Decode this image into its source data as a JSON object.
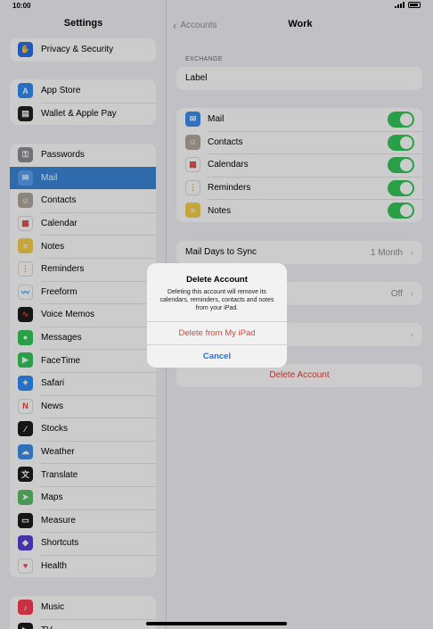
{
  "status": {
    "time": "10:00"
  },
  "sidebar": {
    "title": "Settings",
    "groups": [
      {
        "items": [
          {
            "label": "Privacy & Security",
            "icon": "hand-icon",
            "color": "#2c6de6"
          }
        ]
      },
      {
        "items": [
          {
            "label": "App Store",
            "icon": "app-store-icon",
            "color": "#2f8cf6"
          },
          {
            "label": "Wallet & Apple Pay",
            "icon": "wallet-icon",
            "color": "#222222"
          }
        ]
      },
      {
        "items": [
          {
            "label": "Passwords",
            "icon": "key-icon",
            "color": "#8e8e93"
          },
          {
            "label": "Mail",
            "icon": "mail-icon",
            "color": "#3d8ef0",
            "selected": true
          },
          {
            "label": "Contacts",
            "icon": "contacts-icon",
            "color": "#b0a89c"
          },
          {
            "label": "Calendar",
            "icon": "calendar-icon",
            "color": "#ffffff"
          },
          {
            "label": "Notes",
            "icon": "notes-icon",
            "color": "#f7d04a"
          },
          {
            "label": "Reminders",
            "icon": "reminders-icon",
            "color": "#ffffff"
          },
          {
            "label": "Freeform",
            "icon": "freeform-icon",
            "color": "#ffffff"
          },
          {
            "label": "Voice Memos",
            "icon": "voice-memos-icon",
            "color": "#1c1c1e"
          },
          {
            "label": "Messages",
            "icon": "messages-icon",
            "color": "#34c759"
          },
          {
            "label": "FaceTime",
            "icon": "facetime-icon",
            "color": "#34c759"
          },
          {
            "label": "Safari",
            "icon": "safari-icon",
            "color": "#2f8cf6"
          },
          {
            "label": "News",
            "icon": "news-icon",
            "color": "#ffffff"
          },
          {
            "label": "Stocks",
            "icon": "stocks-icon",
            "color": "#1c1c1e"
          },
          {
            "label": "Weather",
            "icon": "weather-icon",
            "color": "#3c8ee6"
          },
          {
            "label": "Translate",
            "icon": "translate-icon",
            "color": "#1c1c1e"
          },
          {
            "label": "Maps",
            "icon": "maps-icon",
            "color": "#5cbf6a"
          },
          {
            "label": "Measure",
            "icon": "measure-icon",
            "color": "#1c1c1e"
          },
          {
            "label": "Shortcuts",
            "icon": "shortcuts-icon",
            "color": "#5a3fd1"
          },
          {
            "label": "Health",
            "icon": "health-icon",
            "color": "#ffffff"
          }
        ]
      },
      {
        "items": [
          {
            "label": "Music",
            "icon": "music-icon",
            "color": "#fa3e55"
          },
          {
            "label": "TV",
            "icon": "tv-icon",
            "color": "#1c1c1e"
          }
        ]
      }
    ]
  },
  "detail": {
    "back_label": "Accounts",
    "title": "Work",
    "exchange_header": "EXCHANGE",
    "label_row": "Label",
    "services": [
      {
        "label": "Mail",
        "icon": "mail-icon",
        "color": "#3d8ef0"
      },
      {
        "label": "Contacts",
        "icon": "contacts-icon",
        "color": "#b0a89c"
      },
      {
        "label": "Calendars",
        "icon": "calendar-icon",
        "color": "#ffffff"
      },
      {
        "label": "Reminders",
        "icon": "reminders-icon",
        "color": "#ffffff"
      },
      {
        "label": "Notes",
        "icon": "notes-icon",
        "color": "#f7d04a"
      }
    ],
    "mail_days_label": "Mail Days to Sync",
    "mail_days_value": "1 Month",
    "hidden_value": "Off",
    "delete_account": "Delete Account"
  },
  "alert": {
    "title": "Delete Account",
    "message": "Deleting this account will remove its calendars, reminders, contacts and notes from your iPad.",
    "destructive_label": "Delete from My iPad",
    "cancel_label": "Cancel"
  },
  "colors": {
    "accent": "#3a85d8",
    "toggle_on": "#34c759",
    "destructive": "#e0443e"
  }
}
